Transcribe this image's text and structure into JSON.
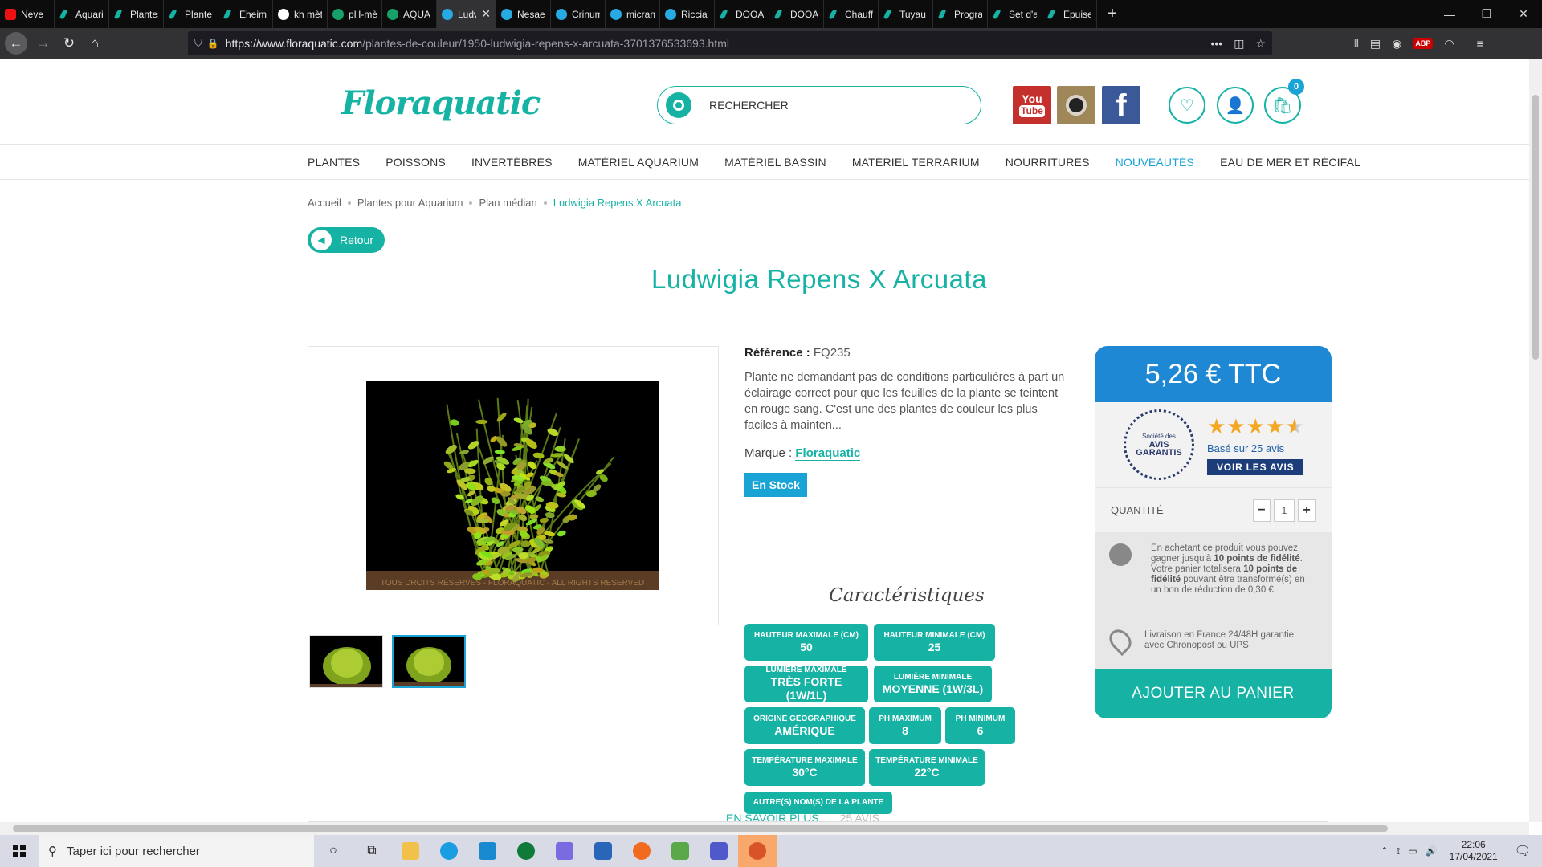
{
  "browser": {
    "tabs": [
      {
        "title": "Neve",
        "icon": "youtube-icon"
      },
      {
        "title": "Aquariu",
        "icon": "floraquatic-icon"
      },
      {
        "title": "Plantes",
        "icon": "floraquatic-icon"
      },
      {
        "title": "Plante à",
        "icon": "floraquatic-icon"
      },
      {
        "title": "Eheim S",
        "icon": "floraquatic-icon"
      },
      {
        "title": "kh mètr",
        "icon": "google-icon"
      },
      {
        "title": "pH-mèt",
        "icon": "fish-icon"
      },
      {
        "title": "AQUA S",
        "icon": "aqua-icon"
      },
      {
        "title": "Ludwi",
        "icon": "globe-icon",
        "active": true
      },
      {
        "title": "Nesaea",
        "icon": "globe-icon"
      },
      {
        "title": "Crinum",
        "icon": "globe-icon"
      },
      {
        "title": "micrant",
        "icon": "globe-icon"
      },
      {
        "title": "Riccia Fl",
        "icon": "globe-icon"
      },
      {
        "title": "DOOA A",
        "icon": "floraquatic-icon"
      },
      {
        "title": "DOOA A",
        "icon": "floraquatic-icon"
      },
      {
        "title": "Chauffa",
        "icon": "floraquatic-icon"
      },
      {
        "title": "Tuyau à",
        "icon": "floraquatic-icon"
      },
      {
        "title": "Program",
        "icon": "floraquatic-icon"
      },
      {
        "title": "Set d'aé",
        "icon": "floraquatic-icon"
      },
      {
        "title": "Epuiset",
        "icon": "floraquatic-icon"
      }
    ],
    "url_host": "https://www.floraquatic.com",
    "url_path": "/plantes-de-couleur/1950-ludwigia-repens-x-arcuata-3701376533693.html"
  },
  "header": {
    "logo": "Floraquatic",
    "search_placeholder": "RECHERCHER",
    "youtube_label": "You",
    "youtube_tube": "Tube",
    "facebook_label": "f",
    "cart_count": "0"
  },
  "menu": [
    "PLANTES",
    "POISSONS",
    "INVERTÉBRÉS",
    "MATÉRIEL AQUARIUM",
    "MATÉRIEL BASSIN",
    "MATÉRIEL TERRARIUM",
    "NOURRITURES",
    "NOUVEAUTÉS",
    "EAU DE MER ET RÉCIFAL"
  ],
  "breadcrumb": [
    "Accueil",
    "Plantes pour Aquarium",
    "Plan médian",
    "Ludwigia Repens X Arcuata"
  ],
  "back_label": "Retour",
  "product": {
    "title": "Ludwigia Repens X Arcuata",
    "reference_label": "Référence :",
    "reference": "FQ235",
    "description": "Plante ne demandant pas de conditions particulières à part un éclairage correct pour que les feuilles de la plante se teintent en rouge sang. C'est une des plantes de couleur les plus faciles à mainten...",
    "brand_label": "Marque :",
    "brand": "Floraquatic",
    "stock": "En Stock",
    "watermark": "TOUS DROITS RÉSERVÉS - FLORAQUATIC - ALL RIGHTS RESERVED"
  },
  "characteristics": {
    "heading": "Caractéristiques",
    "items": [
      {
        "key": "HAUTEUR MAXIMALE (CM)",
        "value": "50"
      },
      {
        "key": "HAUTEUR MINIMALE (CM)",
        "value": "25"
      },
      {
        "key": "LUMIÈRE MAXIMALE",
        "value": "TRÈS FORTE (1W/1L)"
      },
      {
        "key": "LUMIÈRE MINIMALE",
        "value": "MOYENNE (1W/3L)"
      },
      {
        "key": "ORIGINE GÉOGRAPHIQUE",
        "value": "AMÉRIQUE"
      },
      {
        "key": "PH MAXIMUM",
        "value": "8"
      },
      {
        "key": "PH MINIMUM",
        "value": "6"
      },
      {
        "key": "TEMPÉRATURE MAXIMALE",
        "value": "30°C"
      },
      {
        "key": "TEMPÉRATURE MINIMALE",
        "value": "22°C"
      },
      {
        "key": "AUTRE(S) NOM(S) DE LA PLANTE",
        "value": ""
      }
    ]
  },
  "purchase": {
    "price": "5,26 € TTC",
    "avis_small": "Société des",
    "avis_big": "AVIS GARANTIS",
    "rating": 4.5,
    "based_on": "Basé sur 25 avis",
    "see_reviews": "VOIR LES AVIS",
    "quantity_label": "QUANTITÉ",
    "quantity": "1",
    "loyalty_pre": "En achetant ce produit vous pouvez gagner jusqu'à",
    "loyalty_points": "10 points de fidélité",
    "loyalty_mid": ". Votre panier totalisera",
    "loyalty_points2": "10 points de fidélité",
    "loyalty_post": "pouvant être transformé(s) en un bon de réduction de 0,30 €.",
    "delivery": "Livraison en France 24/48H garantie avec Chronopost ou UPS",
    "add_to_cart": "AJOUTER AU PANIER"
  },
  "bottom_tabs": [
    "EN SAVOIR PLUS",
    "25 AVIS"
  ],
  "taskbar": {
    "search_placeholder": "Taper ici pour rechercher",
    "time": "22:06",
    "date": "17/04/2021"
  },
  "colors": {
    "teal": "#16b3a5",
    "blue": "#1aa4d6",
    "price_blue": "#1e88d4"
  }
}
